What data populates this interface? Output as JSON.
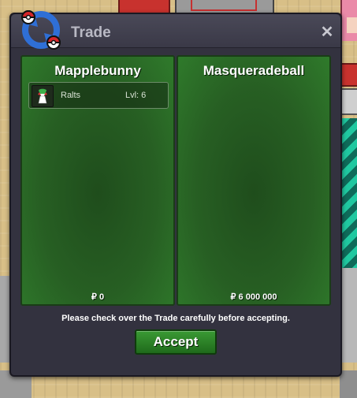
{
  "window": {
    "title": "Trade",
    "close_glyph": "✕",
    "icon": "trade-exchange-icon"
  },
  "panels": [
    {
      "player_name": "Mapplebunny",
      "money": "₽ 0",
      "items": [
        {
          "name": "Ralts",
          "level": "Lvl: 6",
          "icon": "ralts-pokemon-icon"
        }
      ]
    },
    {
      "player_name": "Masqueradeball",
      "money": "₽ 6 000 000",
      "items": []
    }
  ],
  "notice": "Please check over the Trade carefully before accepting.",
  "accept_label": "Accept",
  "colors": {
    "panel_green": "#2f7a2b",
    "window_bg": "#33323f",
    "accept_green": "#2f8a2a",
    "title_text": "#b9b9c4"
  }
}
